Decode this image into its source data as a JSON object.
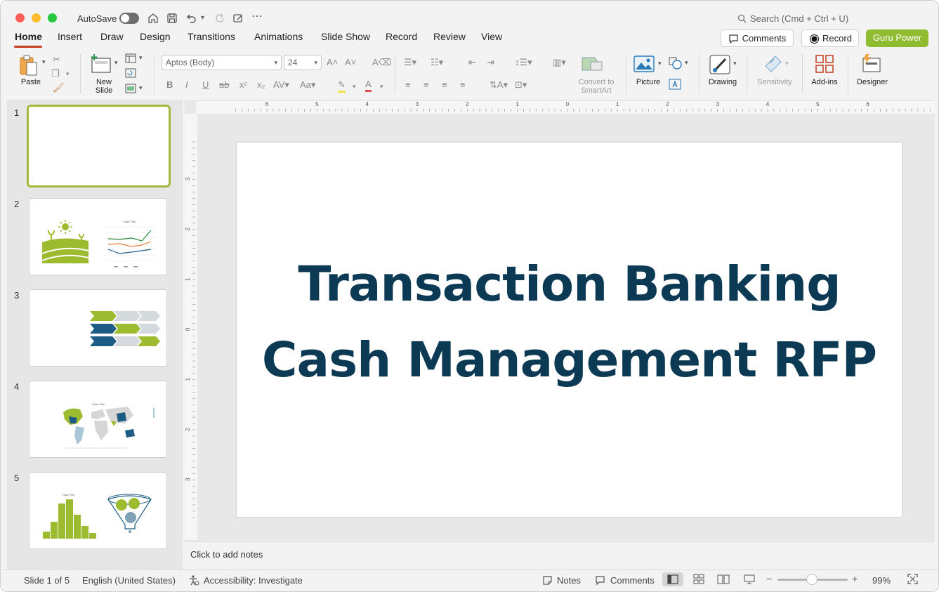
{
  "titlebar": {
    "autosave_label": "AutoSave",
    "search_placeholder": "Search (Cmd + Ctrl + U)"
  },
  "tabs": [
    "Home",
    "Insert",
    "Draw",
    "Design",
    "Transitions",
    "Animations",
    "Slide Show",
    "Record",
    "Review",
    "View"
  ],
  "active_tab": "Home",
  "right_buttons": {
    "comments": "Comments",
    "record": "Record",
    "guru": "Guru Power"
  },
  "ribbon": {
    "paste": "Paste",
    "new_slide": "New\nSlide",
    "font_name": "Aptos (Body)",
    "font_size": "24",
    "convert_smartart": "Convert to\nSmartArt",
    "picture": "Picture",
    "drawing": "Drawing",
    "sensitivity": "Sensitivity",
    "addins": "Add-ins",
    "designer": "Designer"
  },
  "thumbnails": [
    {
      "number": "1"
    },
    {
      "number": "2",
      "chart_title": "Chart Title"
    },
    {
      "number": "3"
    },
    {
      "number": "4",
      "chart_title": "Chart Title"
    },
    {
      "number": "5",
      "chart_title": "Chart Title"
    }
  ],
  "slide": {
    "line1": "Transaction Banking",
    "line2": "Cash Management RFP"
  },
  "ruler": {
    "h_labels": [
      "6",
      "5",
      "4",
      "3",
      "2",
      "1",
      "0",
      "1",
      "2",
      "3",
      "4",
      "5",
      "6"
    ],
    "v_labels": [
      "3",
      "2",
      "1",
      "0",
      "1",
      "2",
      "3"
    ]
  },
  "notes_placeholder": "Click to add notes",
  "status": {
    "slide_info": "Slide 1 of 5",
    "language": "English (United States)",
    "accessibility": "Accessibility: Investigate",
    "notes": "Notes",
    "comments": "Comments",
    "zoom": "99%"
  },
  "colors": {
    "accent_tab": "#c43e1c",
    "title_text": "#0c3a55",
    "guru_button": "#8fbc30",
    "selected_thumb_border": "#a4b93a",
    "thumb_green": "#9dbb2f",
    "thumb_blue": "#1d5c84"
  }
}
